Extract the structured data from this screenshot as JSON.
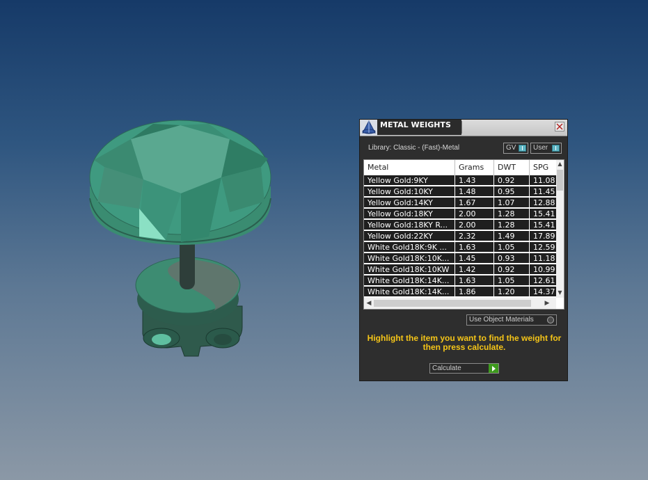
{
  "panel": {
    "title": "METAL WEIGHTS",
    "close_icon": "close-icon",
    "logo_icon": "matrix-logo-icon",
    "library_label": "Library: Classic - (Fast)-Metal",
    "toggle_gv_label": "GV",
    "toggle_user_label": "User",
    "use_object_materials_label": "Use Object Materials",
    "instructions": "Highlight the item you want to find the weight for then press calculate.",
    "calculate_label": "Calculate"
  },
  "table": {
    "columns": [
      "Metal",
      "Grams",
      "DWT",
      "SPG"
    ],
    "rows": [
      [
        "Yellow Gold:9KY",
        "1.43",
        "0.92",
        "11.08"
      ],
      [
        "Yellow Gold:10KY",
        "1.48",
        "0.95",
        "11.45"
      ],
      [
        "Yellow Gold:14KY",
        "1.67",
        "1.07",
        "12.88"
      ],
      [
        "Yellow Gold:18KY",
        "2.00",
        "1.28",
        "15.41"
      ],
      [
        "Yellow Gold:18KY R...",
        "2.00",
        "1.28",
        "15.41"
      ],
      [
        "Yellow Gold:22KY",
        "2.32",
        "1.49",
        "17.89"
      ],
      [
        "White Gold18K:9K ...",
        "1.63",
        "1.05",
        "12.59"
      ],
      [
        "White Gold18K:10K...",
        "1.45",
        "0.93",
        "11.18"
      ],
      [
        "White Gold18K:10KW",
        "1.42",
        "0.92",
        "10.99"
      ],
      [
        "White Gold18K:14K...",
        "1.63",
        "1.05",
        "12.61"
      ],
      [
        "White Gold18K:14K...",
        "1.86",
        "1.20",
        "14.37"
      ]
    ]
  },
  "colors": {
    "panel_bg": "#2e2e2e",
    "instruction_text": "#f5c518",
    "gem": "#3f9a80",
    "toggle_knob": "#5fb6c4",
    "calculate_arrow": "#3e9a1e"
  }
}
